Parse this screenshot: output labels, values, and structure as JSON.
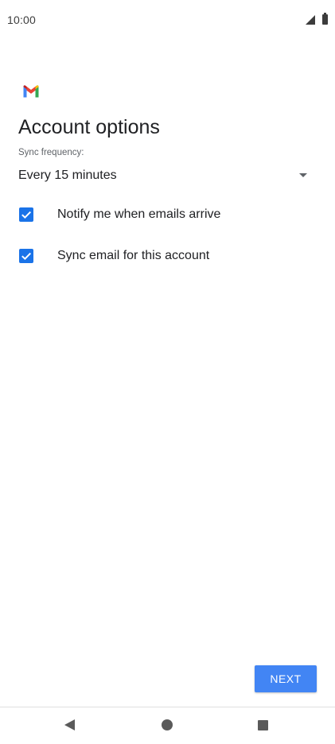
{
  "status_bar": {
    "time": "10:00",
    "icons": [
      "signal-icon",
      "battery-icon"
    ]
  },
  "header": {
    "logo_icon": "gmail-icon",
    "title": "Account options"
  },
  "sync": {
    "label": "Sync frequency:",
    "selected": "Every 15 minutes"
  },
  "options": [
    {
      "label": "Notify me when emails arrive",
      "checked": true
    },
    {
      "label": "Sync email for this account",
      "checked": true
    }
  ],
  "actions": {
    "next_label": "NEXT"
  },
  "nav_bar": {
    "icons": [
      "back-icon",
      "home-icon",
      "recents-icon"
    ]
  },
  "colors": {
    "accent": "#4285f4",
    "checkbox": "#1a73e8"
  }
}
